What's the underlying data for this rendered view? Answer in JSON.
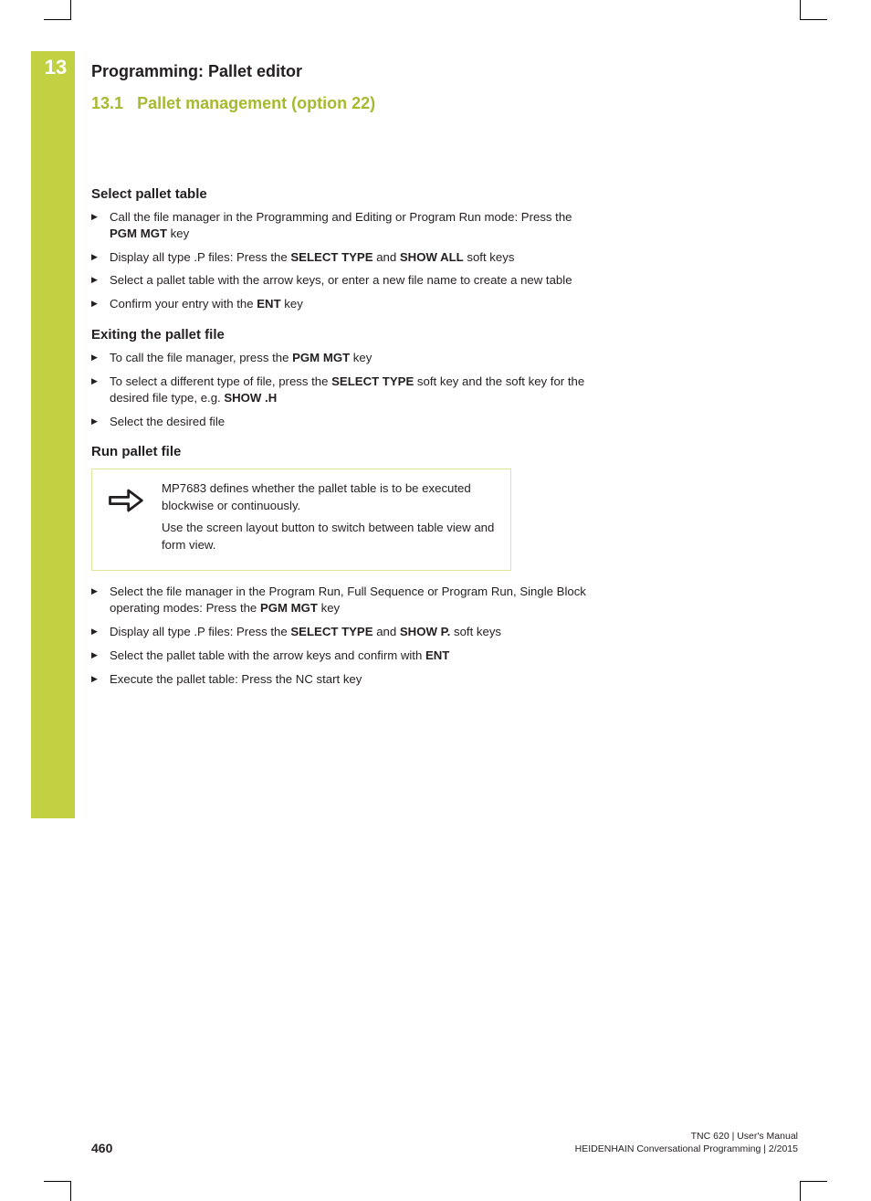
{
  "chapter": {
    "number": "13",
    "title": "Programming: Pallet editor",
    "section_number": "13.1",
    "section_title": "Pallet management (option 22)"
  },
  "sections": [
    {
      "heading": "Select pallet table",
      "items": [
        {
          "pre": "Call the file manager in the Programming and Editing or Program Run mode: Press the ",
          "bold1": "PGM MGT",
          "post1": " key"
        },
        {
          "pre": "Display all type .P files: Press the ",
          "bold1": "SELECT TYPE",
          "mid": " and ",
          "bold2": "SHOW ALL",
          "post2": " soft keys"
        },
        {
          "pre": "Select a pallet table with the arrow keys, or enter a new file name to create a new table"
        },
        {
          "pre": "Confirm your entry with the ",
          "bold1": "ENT",
          "post1": " key"
        }
      ]
    },
    {
      "heading": "Exiting the pallet file",
      "items": [
        {
          "pre": "To call the file manager, press the ",
          "bold1": "PGM MGT",
          "post1": " key"
        },
        {
          "pre": "To select a different type of file, press the ",
          "bold1": "SELECT TYPE",
          "mid": " soft key and the soft key for the desired file type, e.g. ",
          "bold2": "SHOW .H"
        },
        {
          "pre": "Select the desired file"
        }
      ]
    },
    {
      "heading": "Run pallet file",
      "note": {
        "p1": "MP7683 defines whether the pallet table is to be executed blockwise or continuously.",
        "p2": "Use the screen layout button to switch between table view and form view."
      },
      "items": [
        {
          "pre": "Select the file manager in the Program Run, Full Sequence or Program Run, Single Block operating modes: Press the ",
          "bold1": "PGM MGT",
          "post1": " key"
        },
        {
          "pre": "Display all type .P files: Press the ",
          "bold1": "SELECT TYPE",
          "mid": " and ",
          "bold2": "SHOW P.",
          "post2": " soft keys"
        },
        {
          "pre": "Select the pallet table with the arrow keys and confirm with ",
          "bold1": "ENT"
        },
        {
          "pre": "Execute the pallet table: Press the NC start key"
        }
      ]
    }
  ],
  "footer": {
    "page": "460",
    "line1": "TNC 620 | User's Manual",
    "line2": "HEIDENHAIN Conversational Programming | 2/2015"
  }
}
